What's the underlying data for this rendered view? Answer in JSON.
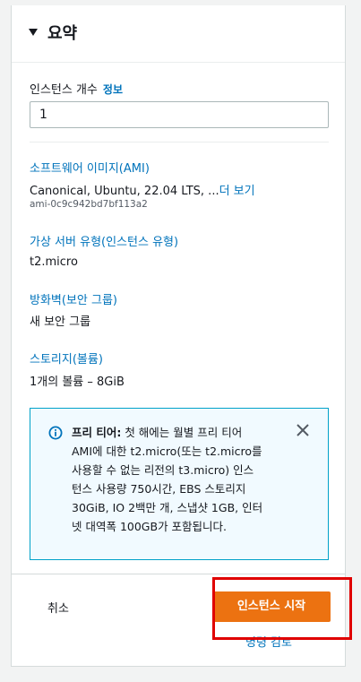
{
  "summary": {
    "title": "요약",
    "instance_count_label": "인스턴스 개수",
    "info_link": "정보",
    "instance_count_value": "1",
    "ami_label": "소프트웨어 이미지(AMI)",
    "ami_value": "Canonical, Ubuntu, 22.04 LTS, ...",
    "ami_more": "더 보기",
    "ami_id": "ami-0c9c942bd7bf113a2",
    "instance_type_label": "가상 서버 유형(인스턴스 유형)",
    "instance_type_value": "t2.micro",
    "firewall_label": "방화벽(보안 그룹)",
    "firewall_value": "새 보안 그룹",
    "storage_label": "스토리지(볼륨)",
    "storage_value": "1개의 볼륨 – 8GiB"
  },
  "alert": {
    "bold": "프리 티어:",
    "lines": [
      " 첫 해에는 월별 프리 티어",
      "AMI에 대한 t2.micro(또는 t2.micro를",
      "사용할 수 없는 리전의 t3.micro) 인스",
      "턴스 사용량 750시간, EBS 스토리지",
      "30GiB, IO 2백만 개, 스냅샷 1GB, 인터",
      "넷 대역폭 100GB가 포함됩니다."
    ],
    "icon": "info-icon",
    "close_icon": "close-icon"
  },
  "footer": {
    "cancel": "취소",
    "launch": "인스턴스 시작",
    "review": "명령 검토"
  },
  "colors": {
    "link": "#0073bb",
    "primary": "#ec7211",
    "highlight": "#e00000",
    "alert_border": "#00a1c9"
  }
}
